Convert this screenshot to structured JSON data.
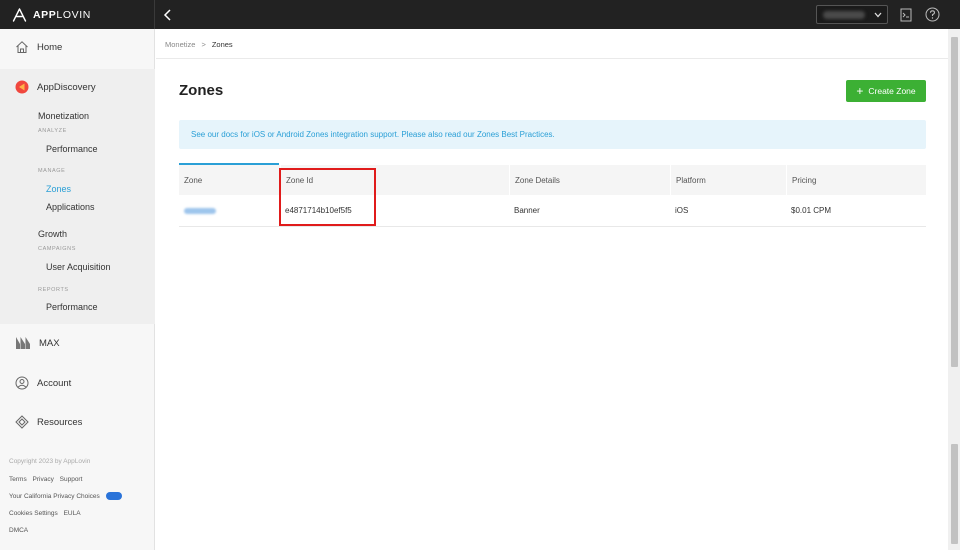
{
  "brand": {
    "name_bold": "APP",
    "name_rest": "LOVIN"
  },
  "sidebar": {
    "home": "Home",
    "appdiscovery": "AppDiscovery",
    "monetization": {
      "title": "Monetization",
      "analyze": "ANALYZE",
      "performance": "Performance",
      "manage": "MANAGE",
      "zones": "Zones",
      "applications": "Applications"
    },
    "growth": {
      "title": "Growth",
      "campaigns": "CAMPAIGNS",
      "user_acquisition": "User Acquisition",
      "reports": "REPORTS",
      "performance": "Performance"
    },
    "max": "MAX",
    "account": "Account",
    "resources": "Resources",
    "footer": {
      "copyright": "Copyright 2023 by AppLovin",
      "terms": "Terms",
      "privacy": "Privacy",
      "support": "Support",
      "ca_privacy": "Your California Privacy Choices",
      "cookies": "Cookies Settings",
      "eula": "EULA",
      "dmca": "DMCA"
    }
  },
  "breadcrumb": {
    "parent": "Monetize",
    "separator": ">",
    "current": "Zones"
  },
  "page": {
    "title": "Zones",
    "create_button": "Create Zone",
    "info": "See our docs for iOS or Android Zones integration support. Please also read our Zones Best Practices."
  },
  "table": {
    "headers": [
      "Zone",
      "Zone Id",
      "Zone Details",
      "Platform",
      "Pricing"
    ],
    "rows": [
      {
        "zone_id": "e4871714b10ef5f5",
        "details": "Banner",
        "platform": "iOS",
        "pricing": "$0.01 CPM"
      }
    ]
  },
  "colors": {
    "accent": "#2a9fd6",
    "create_button": "#3cb034",
    "highlight": "#e01b1b",
    "topbar": "#222222"
  }
}
